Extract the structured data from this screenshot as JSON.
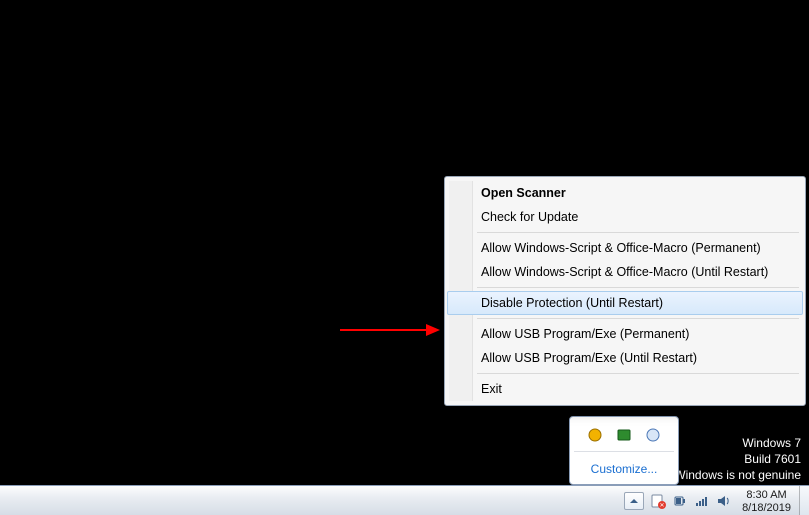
{
  "context_menu": {
    "items": [
      {
        "label": "Open Scanner",
        "bold": true
      },
      {
        "label": "Check for Update"
      },
      {
        "sep": true
      },
      {
        "label": "Allow Windows-Script & Office-Macro (Permanent)"
      },
      {
        "label": "Allow Windows-Script & Office-Macro (Until Restart)"
      },
      {
        "sep": true
      },
      {
        "label": "Disable Protection (Until Restart)",
        "highlighted": true
      },
      {
        "sep": true
      },
      {
        "label": "Allow USB Program/Exe (Permanent)"
      },
      {
        "label": "Allow USB Program/Exe (Until Restart)"
      },
      {
        "sep": true
      },
      {
        "label": "Exit"
      }
    ]
  },
  "tray_popup": {
    "customize_label": "Customize..."
  },
  "watermark": {
    "line1": "Windows 7",
    "line2": "Build 7601",
    "line3": "This copy of Windows is not genuine"
  },
  "taskbar": {
    "time": "8:30 AM",
    "date": "8/18/2019"
  },
  "colors": {
    "menu_highlight_border": "#a9cdee",
    "menu_highlight_bg_top": "#eaf3fe",
    "menu_highlight_bg_bottom": "#d7e9fb",
    "link": "#1b6fd1",
    "arrow": "#ff0000"
  }
}
